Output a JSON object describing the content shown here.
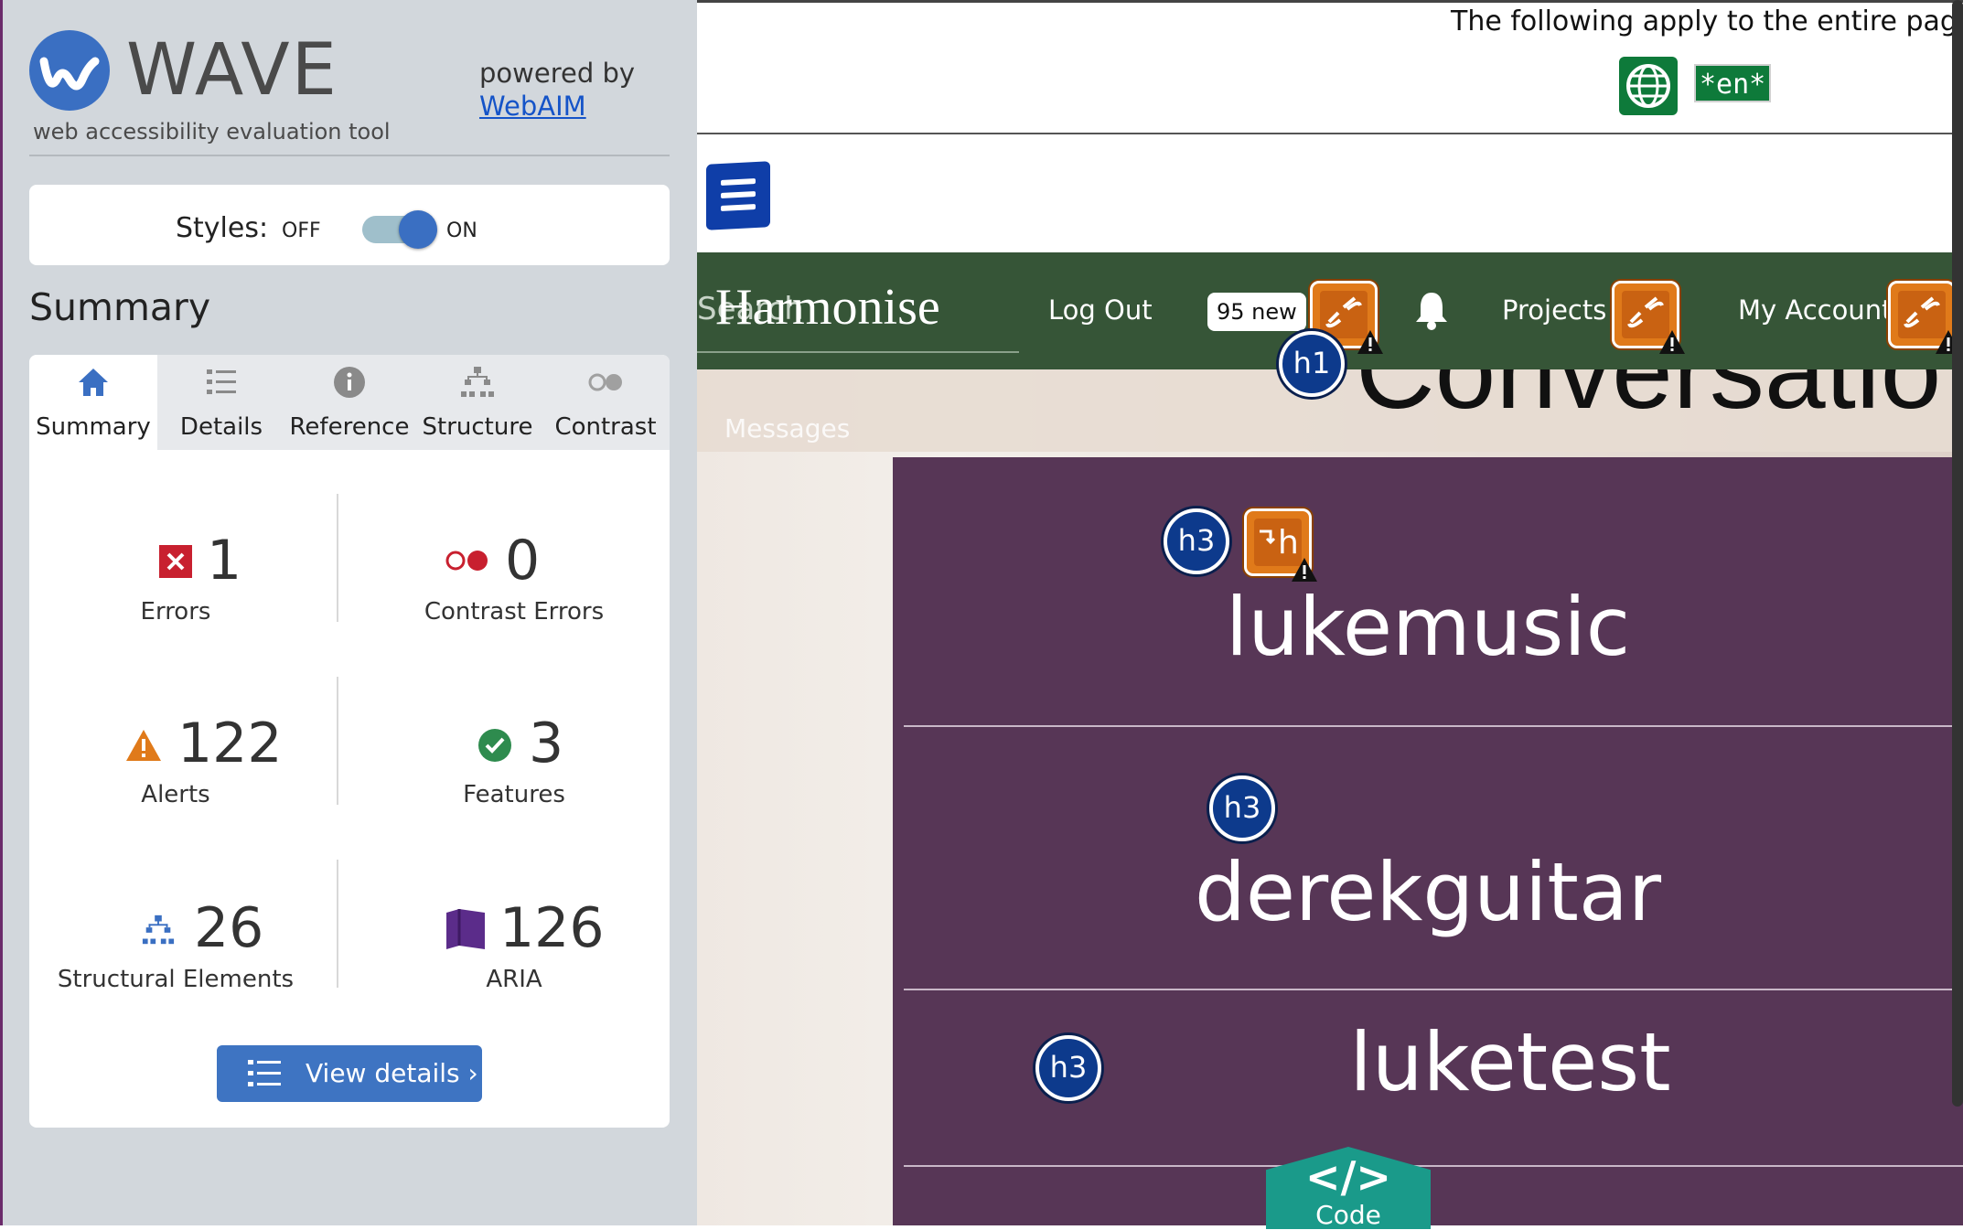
{
  "wave": {
    "logo_title": "WAVE",
    "logo_subtitle": "web accessibility evaluation tool",
    "powered_by": "powered by",
    "webaim_link": "WebAIM",
    "styles_label": "Styles:",
    "styles_off": "OFF",
    "styles_on": "ON",
    "summary_heading": "Summary",
    "tabs": [
      {
        "label": "Summary",
        "icon": "home-icon",
        "active": true
      },
      {
        "label": "Details",
        "icon": "list-icon",
        "active": false
      },
      {
        "label": "Reference",
        "icon": "info-icon",
        "active": false
      },
      {
        "label": "Structure",
        "icon": "hierarchy-icon",
        "active": false
      },
      {
        "label": "Contrast",
        "icon": "contrast-icon",
        "active": false
      }
    ],
    "stats": {
      "errors": {
        "count": "1",
        "label": "Errors"
      },
      "contrast": {
        "count": "0",
        "label": "Contrast Errors"
      },
      "alerts": {
        "count": "122",
        "label": "Alerts"
      },
      "features": {
        "count": "3",
        "label": "Features"
      },
      "structural": {
        "count": "26",
        "label": "Structural Elements"
      },
      "aria": {
        "count": "126",
        "label": "ARIA"
      }
    },
    "view_details": "View details ›"
  },
  "page": {
    "apply_text": "The following apply to the entire page:",
    "lang_badge": "*en*",
    "search_ghost": "Search",
    "brand": "Harmonise",
    "nav": {
      "logout": "Log Out",
      "new_badge": "95 new",
      "projects": "Projects",
      "account": "My Account"
    },
    "heading_partial": "Conversatio",
    "messages_label": "Messages",
    "h1_badge": "h1",
    "h3_badge": "h3",
    "h_icon_text": "h",
    "usernames": [
      "lukemusic",
      "derekguitar",
      "luketest"
    ],
    "code_tab": {
      "symbol": "</>",
      "label": "Code"
    }
  },
  "colors": {
    "sidebar_bg": "#d2d7dc",
    "wave_blue": "#3a6fc2",
    "nav_green": "#365537",
    "card_purple": "#573656",
    "alert_orange": "#e07a1a",
    "heading_badge_blue": "#0d3a8c",
    "code_teal": "#1a9a8a"
  }
}
